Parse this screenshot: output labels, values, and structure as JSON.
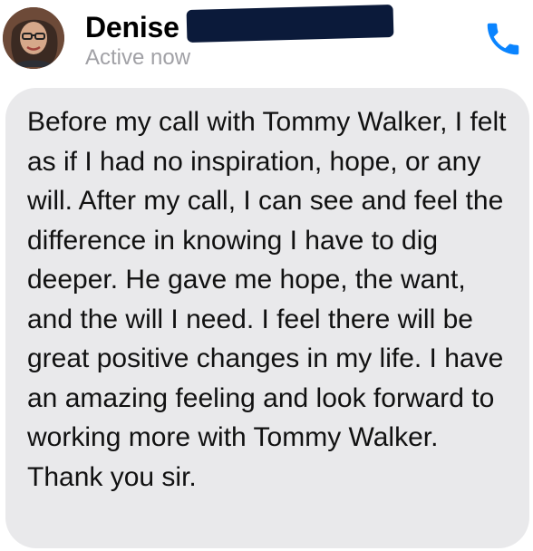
{
  "header": {
    "contact_name": "Denise",
    "status": "Active now",
    "avatar_icon": "profile-photo",
    "call_icon": "phone-icon",
    "accent_color": "#0a84ff",
    "redaction_color": "#0b1a3a"
  },
  "conversation": {
    "messages": [
      {
        "text": "Before my call with Tommy Walker, I felt as if I had no inspiration, hope, or any will. After my call, I can see and feel the difference in knowing I have to dig deeper. He gave me hope, the want, and the will I need. I feel there will be great positive changes in my life. I have an amazing feeling and look forward to working more with Tommy Walker. Thank you sir.",
        "bubble_color": "#e9e9eb"
      }
    ]
  }
}
